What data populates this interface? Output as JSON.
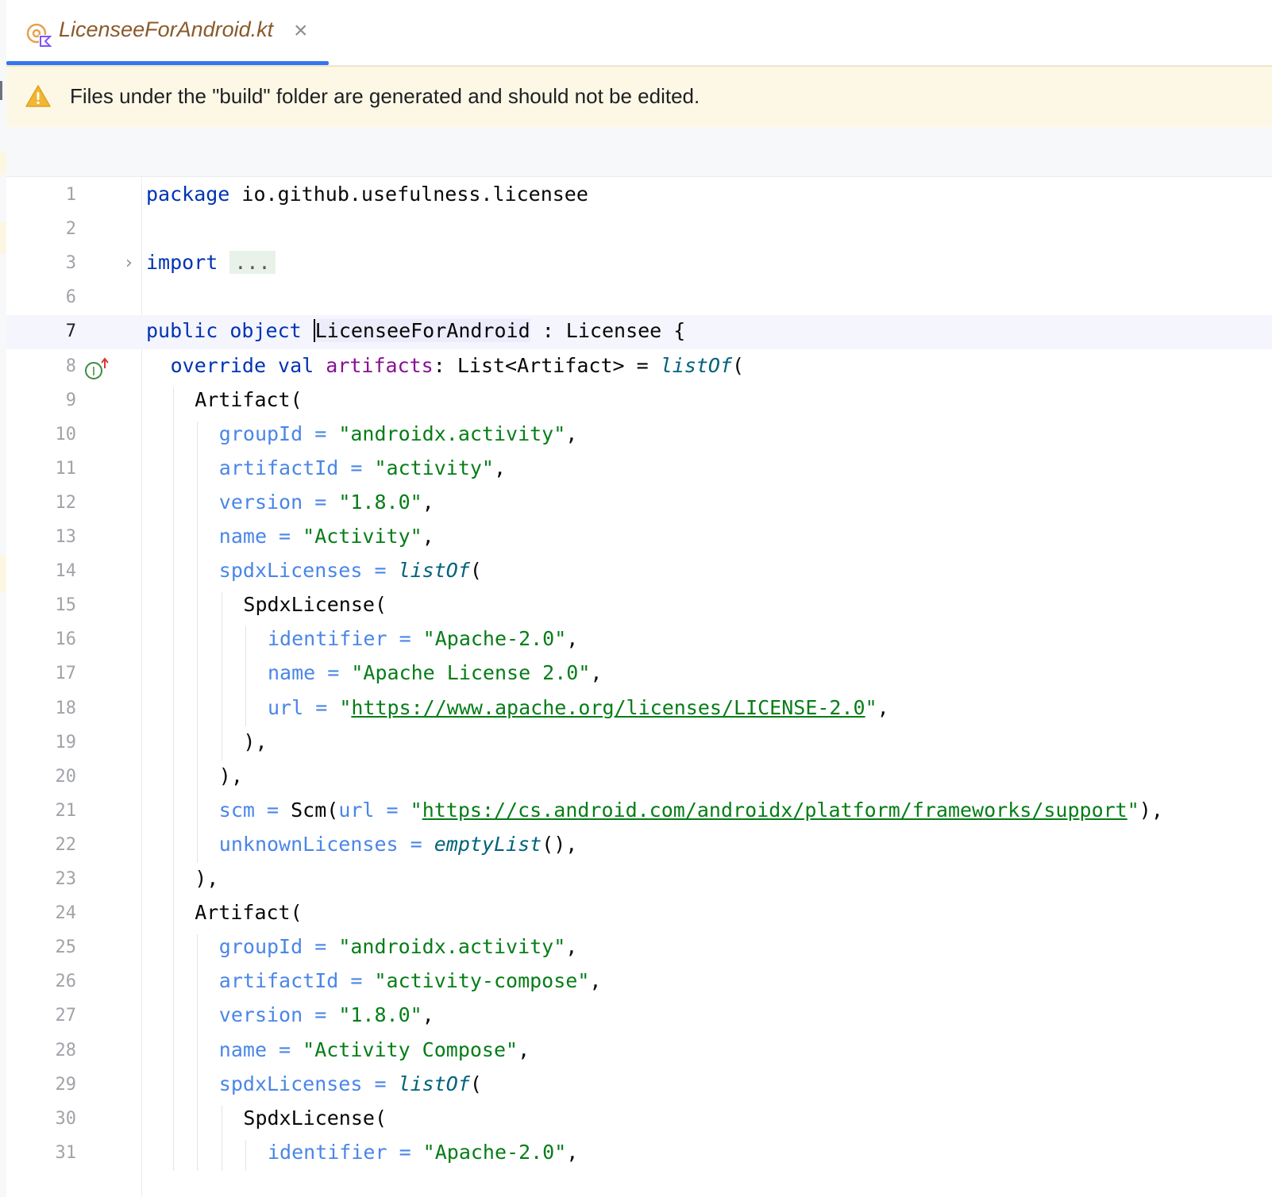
{
  "tab": {
    "title": "LicenseeForAndroid.kt",
    "close_symbol": "×",
    "icon": "kotlin-file-icon"
  },
  "banner": {
    "icon": "warning-icon",
    "text": "Files under the \"build\" folder are generated and should not be edited."
  },
  "editor": {
    "current_line": "7",
    "lines": [
      {
        "num": "1",
        "indent": 0,
        "parts": [
          [
            "kw",
            "package"
          ],
          [
            "plain",
            " io.github.usefulness.licensee"
          ]
        ]
      },
      {
        "num": "2",
        "indent": 0,
        "parts": []
      },
      {
        "num": "3",
        "indent": 0,
        "fold": true,
        "parts": [
          [
            "kw",
            "import"
          ],
          [
            "plain",
            " "
          ],
          [
            "fold-box",
            "..."
          ]
        ]
      },
      {
        "num": "6",
        "indent": 0,
        "parts": []
      },
      {
        "num": "7",
        "indent": 0,
        "current": true,
        "parts": [
          [
            "kw",
            "public object "
          ],
          [
            "cls-hl caret",
            "LicenseeForAndroid"
          ],
          [
            "plain",
            " : Licensee {"
          ]
        ]
      },
      {
        "num": "8",
        "indent": 1,
        "impl": true,
        "parts": [
          [
            "kw",
            "override val "
          ],
          [
            "prop",
            "artifacts"
          ],
          [
            "plain",
            ": List<Artifact> = "
          ],
          [
            "fn",
            "listOf"
          ],
          [
            "plain",
            "("
          ]
        ]
      },
      {
        "num": "9",
        "indent": 2,
        "parts": [
          [
            "plain",
            "Artifact("
          ]
        ]
      },
      {
        "num": "10",
        "indent": 3,
        "parts": [
          [
            "named",
            "groupId = "
          ],
          [
            "str",
            "\"androidx.activity\""
          ],
          [
            "plain",
            ","
          ]
        ]
      },
      {
        "num": "11",
        "indent": 3,
        "parts": [
          [
            "named",
            "artifactId = "
          ],
          [
            "str",
            "\"activity\""
          ],
          [
            "plain",
            ","
          ]
        ]
      },
      {
        "num": "12",
        "indent": 3,
        "parts": [
          [
            "named",
            "version = "
          ],
          [
            "str",
            "\"1.8.0\""
          ],
          [
            "plain",
            ","
          ]
        ]
      },
      {
        "num": "13",
        "indent": 3,
        "parts": [
          [
            "named",
            "name = "
          ],
          [
            "str",
            "\"Activity\""
          ],
          [
            "plain",
            ","
          ]
        ]
      },
      {
        "num": "14",
        "indent": 3,
        "parts": [
          [
            "named",
            "spdxLicenses = "
          ],
          [
            "fn",
            "listOf"
          ],
          [
            "plain",
            "("
          ]
        ]
      },
      {
        "num": "15",
        "indent": 4,
        "parts": [
          [
            "plain",
            "SpdxLicense("
          ]
        ]
      },
      {
        "num": "16",
        "indent": 5,
        "parts": [
          [
            "named",
            "identifier = "
          ],
          [
            "str",
            "\"Apache-2.0\""
          ],
          [
            "plain",
            ","
          ]
        ]
      },
      {
        "num": "17",
        "indent": 5,
        "parts": [
          [
            "named",
            "name = "
          ],
          [
            "str",
            "\"Apache License 2.0\""
          ],
          [
            "plain",
            ","
          ]
        ]
      },
      {
        "num": "18",
        "indent": 5,
        "parts": [
          [
            "named",
            "url = "
          ],
          [
            "str",
            "\""
          ],
          [
            "str url",
            "https://www.apache.org/licenses/LICENSE-2.0"
          ],
          [
            "str",
            "\""
          ],
          [
            "plain",
            ","
          ]
        ]
      },
      {
        "num": "19",
        "indent": 4,
        "parts": [
          [
            "plain",
            "),"
          ]
        ]
      },
      {
        "num": "20",
        "indent": 3,
        "parts": [
          [
            "plain",
            "),"
          ]
        ]
      },
      {
        "num": "21",
        "indent": 3,
        "parts": [
          [
            "named",
            "scm = "
          ],
          [
            "plain",
            "Scm("
          ],
          [
            "named",
            "url = "
          ],
          [
            "str",
            "\""
          ],
          [
            "str url",
            "https://cs.android.com/androidx/platform/frameworks/support"
          ],
          [
            "str",
            "\""
          ],
          [
            "plain",
            "),"
          ]
        ]
      },
      {
        "num": "22",
        "indent": 3,
        "parts": [
          [
            "named",
            "unknownLicenses = "
          ],
          [
            "fn",
            "emptyList"
          ],
          [
            "plain",
            "(),"
          ]
        ]
      },
      {
        "num": "23",
        "indent": 2,
        "parts": [
          [
            "plain",
            "),"
          ]
        ]
      },
      {
        "num": "24",
        "indent": 2,
        "parts": [
          [
            "plain",
            "Artifact("
          ]
        ]
      },
      {
        "num": "25",
        "indent": 3,
        "parts": [
          [
            "named",
            "groupId = "
          ],
          [
            "str",
            "\"androidx.activity\""
          ],
          [
            "plain",
            ","
          ]
        ]
      },
      {
        "num": "26",
        "indent": 3,
        "parts": [
          [
            "named",
            "artifactId = "
          ],
          [
            "str",
            "\"activity-compose\""
          ],
          [
            "plain",
            ","
          ]
        ]
      },
      {
        "num": "27",
        "indent": 3,
        "parts": [
          [
            "named",
            "version = "
          ],
          [
            "str",
            "\"1.8.0\""
          ],
          [
            "plain",
            ","
          ]
        ]
      },
      {
        "num": "28",
        "indent": 3,
        "parts": [
          [
            "named",
            "name = "
          ],
          [
            "str",
            "\"Activity Compose\""
          ],
          [
            "plain",
            ","
          ]
        ]
      },
      {
        "num": "29",
        "indent": 3,
        "parts": [
          [
            "named",
            "spdxLicenses = "
          ],
          [
            "fn",
            "listOf"
          ],
          [
            "plain",
            "("
          ]
        ]
      },
      {
        "num": "30",
        "indent": 4,
        "parts": [
          [
            "plain",
            "SpdxLicense("
          ]
        ]
      },
      {
        "num": "31",
        "indent": 5,
        "parts": [
          [
            "named",
            "identifier = "
          ],
          [
            "str",
            "\"Apache-2.0\""
          ],
          [
            "plain",
            ","
          ]
        ]
      }
    ]
  }
}
